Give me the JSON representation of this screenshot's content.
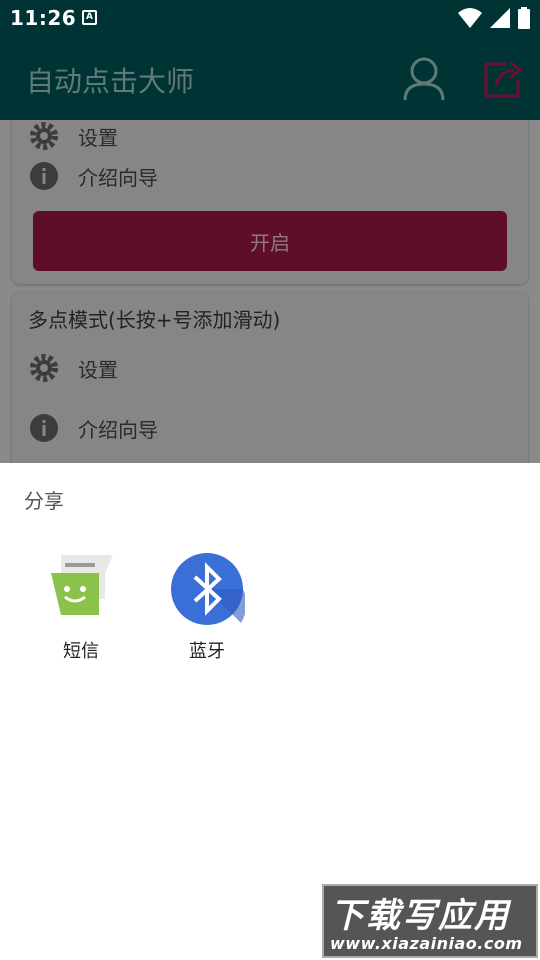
{
  "status": {
    "time": "11:26",
    "notification_glyph": "A"
  },
  "app": {
    "title": "自动点击大师",
    "colors": {
      "bar": "#003333",
      "accent": "#6b0f34"
    }
  },
  "card1": {
    "settings_label": "设置",
    "guide_label": "介绍向导",
    "start_label": "开启"
  },
  "card2": {
    "title": "多点模式(长按+号添加滑动)",
    "settings_label": "设置",
    "guide_label": "介绍向导"
  },
  "share_sheet": {
    "title": "分享",
    "targets": [
      {
        "label": "短信",
        "icon": "messaging-icon"
      },
      {
        "label": "蓝牙",
        "icon": "bluetooth-icon"
      }
    ]
  },
  "watermark": {
    "text": "下载写应用",
    "url": "www.xiazainiao.com"
  }
}
